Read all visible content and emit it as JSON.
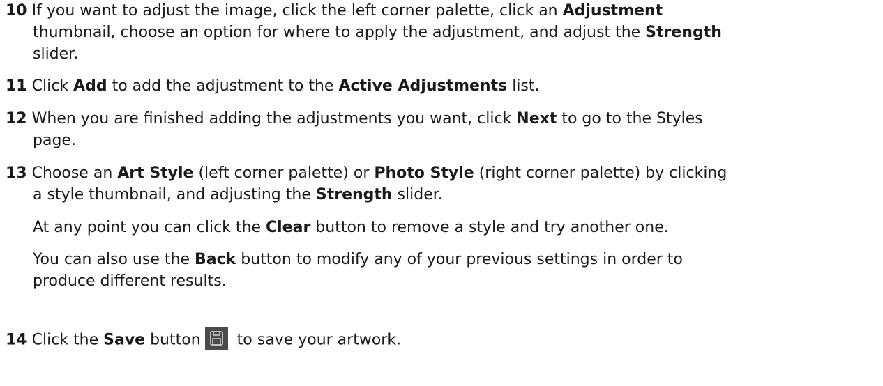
{
  "steps": [
    {
      "number": "10",
      "text1": " If you want to adjust the image, click the left corner palette, click an ",
      "bold1": "Adjustment",
      "text2": "thumbnail, choose an option for where to apply the adjustment, and adjust the ",
      "bold2": "Strength",
      "text3": "slider."
    },
    {
      "number": "11",
      "text1": " Click ",
      "bold1": "Add",
      "text2": " to add the adjustment to the ",
      "bold2": "Active Adjustments",
      "text3": " list."
    },
    {
      "number": "12",
      "text1": " When you are finished adding the adjustments you want, click ",
      "bold1": "Next",
      "text2": " to go to the Styles",
      "text3": "page."
    },
    {
      "number": "13",
      "text1": " Choose an ",
      "bold1": "Art Style",
      "text2": " (left corner palette) or ",
      "bold2": "Photo Style",
      "text3": " (right corner palette) by clicking",
      "text4": "a style thumbnail, and adjusting the ",
      "bold3": "Strength",
      "text5": " slider."
    },
    {
      "number": "14",
      "text1": " Click the ",
      "bold1": "Save",
      "text2": " button",
      "text3": " to save your artwork.",
      "icon": "save-icon"
    }
  ],
  "paragraphs": [
    {
      "text1": "At any point you can click the ",
      "bold1": "Clear",
      "text2": " button to remove a style and try another one."
    },
    {
      "text1": "You can also use the ",
      "bold1": "Back",
      "text2": " button to modify any of your previous settings in order to",
      "text3": "produce different results."
    }
  ]
}
